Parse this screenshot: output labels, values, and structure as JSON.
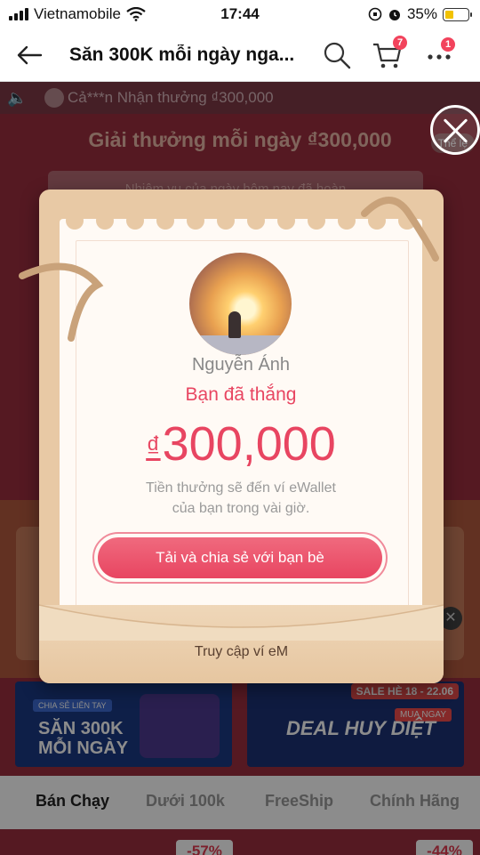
{
  "status_bar": {
    "carrier": "Vietnamobile",
    "time": "17:44",
    "battery": "35%"
  },
  "nav": {
    "title": "Săn 300K mỗi ngày nga...",
    "cart_badge": "7",
    "more_badge": "1"
  },
  "background": {
    "ticker": "Cả***n Nhận thưởng ₫300,000",
    "heading": "Giải thưởng mỗi ngày ₫300,000",
    "rules": "Thể lệ",
    "task": "Nhiệm vụ của ngày hôm nay đã hoàn",
    "banner_left": {
      "brand": "CHIA SẺ LIÊN TAY",
      "line1": "SĂN 300K",
      "line2": "MỖI NGÀY"
    },
    "banner_right": {
      "deal": "DEAL HUY DIỆT",
      "sale": "SALE HÈ 18 - 22.06",
      "cta": "MUA NGAY"
    },
    "tabs": [
      "Bán Chạy",
      "Dưới 100k",
      "FreeShip",
      "Chính Hãng"
    ],
    "discounts": [
      "-57%",
      "-44%"
    ]
  },
  "modal": {
    "username": "Nguyễn Ánh",
    "won_label": "Bạn đã thắng",
    "currency": "₫",
    "amount": "300,000",
    "note_line1": "Tiền thưởng sẽ đến ví eWallet",
    "note_line2": "của bạn trong vài giờ.",
    "share_button": "Tải và chia sẻ với bạn bè",
    "wallet_link": "Truy cập ví eM"
  },
  "colors": {
    "accent": "#e84561",
    "frame": "#e8c9a5",
    "paper": "#fffaf5"
  }
}
